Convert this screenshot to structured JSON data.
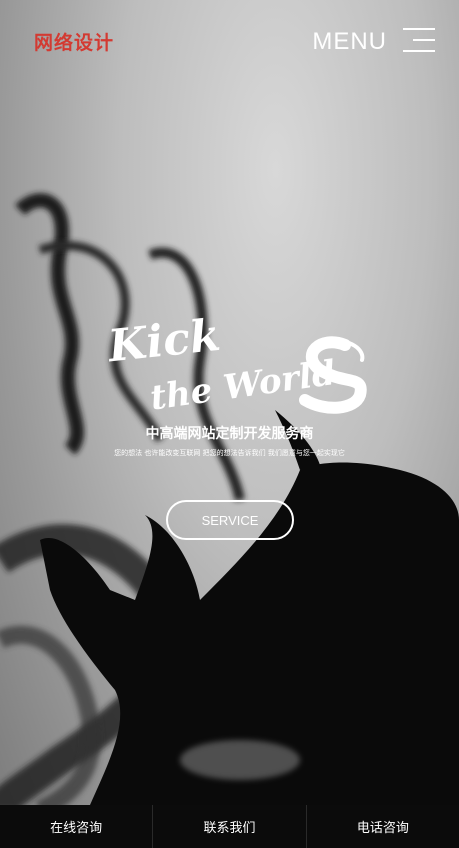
{
  "header": {
    "logo": "网络设计",
    "menu_label": "MENU"
  },
  "hero": {
    "script_line1": "Kick",
    "script_line2": "the World",
    "headline": "中高端网站定制开发服务商",
    "subline": "您的想法  也许能改变互联网  把您的想法告诉我们  我们愿意与您一起实现它",
    "button": "SERVICE"
  },
  "bottom_bar": {
    "items": [
      "在线咨询",
      "联系我们",
      "电话咨询"
    ]
  },
  "colors": {
    "logo": "#d33a32",
    "bar_bg": "#0b0b0b",
    "text": "#ffffff"
  }
}
